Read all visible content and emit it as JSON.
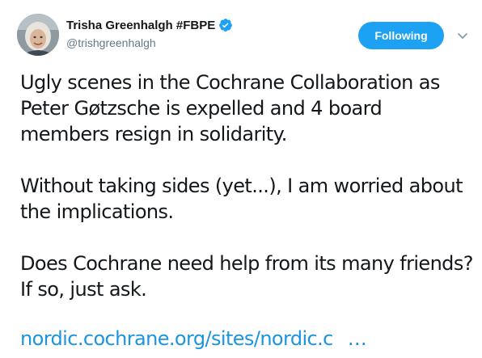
{
  "author": {
    "name": "Trisha Greenhalgh #FBPE",
    "handle": "@trishgreenhalgh",
    "verified_icon": "verified-badge-icon"
  },
  "actions": {
    "follow_label": "Following",
    "menu_icon": "chevron-down-icon"
  },
  "tweet": {
    "paragraphs": [
      "Ugly scenes in the Cochrane Collaboration as Peter Gøtzsche is expelled and 4 board members resign in solidarity.",
      "Without taking sides (yet...), I am worried about the implications.",
      "Does Cochrane need help from its many friends? If so, just ask."
    ],
    "link_text": "nordic.cochrane.org/sites/nordic.c",
    "link_ellipsis": "…"
  },
  "colors": {
    "accent": "#1da1f2",
    "link": "#1b95e0",
    "secondary_text": "#657786",
    "primary_text": "#14171a"
  }
}
